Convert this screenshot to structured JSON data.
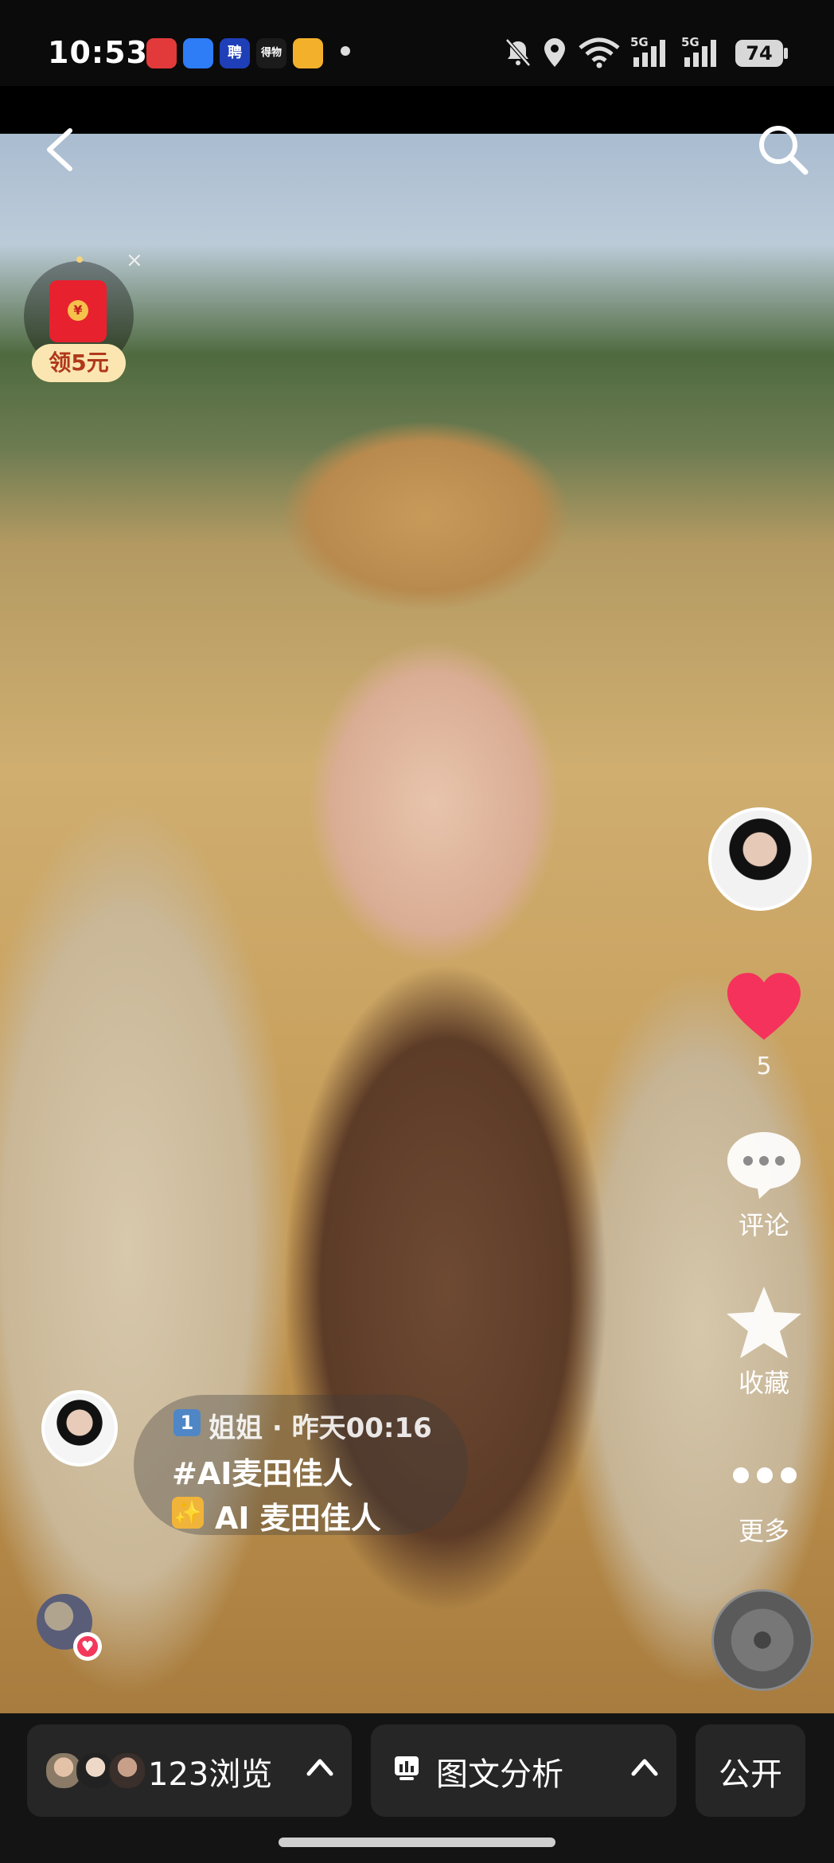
{
  "status_bar": {
    "time": "10:53",
    "apps": [
      {
        "icon": "news-app-icon",
        "color": "#e23a3a",
        "label": ""
      },
      {
        "icon": "files-app-icon",
        "color": "#2e7cf6",
        "label": ""
      },
      {
        "icon": "zhaopin-app-icon",
        "color": "#1f3fb8",
        "label": "聘"
      },
      {
        "icon": "dewu-app-icon",
        "color": "#1b1b1b",
        "label": "得物"
      },
      {
        "icon": "video-app-icon",
        "color": "#f3b12b",
        "label": ""
      }
    ],
    "battery": "74",
    "network_label_1": "5G",
    "network_label_2": "5G"
  },
  "top_nav": {
    "back_icon": "chevron-left-icon",
    "search_icon": "search-icon"
  },
  "red_packet": {
    "label": "领5元",
    "coin": "¥",
    "close": "×"
  },
  "right_rail": {
    "like_count": "5",
    "comment_label": "评论",
    "favorite_label": "收藏",
    "more_label": "更多",
    "like_color": "#f5325c"
  },
  "post_info": {
    "rank": "1",
    "author_time": "姐姐 · 昨天00:16",
    "hashtag": "#AI麦田佳人",
    "title": "AI 麦田佳人",
    "sparkle": "✨"
  },
  "bottom_bar": {
    "views_label": "123浏览",
    "analysis_label": "图文分析",
    "public_label": "公开"
  }
}
